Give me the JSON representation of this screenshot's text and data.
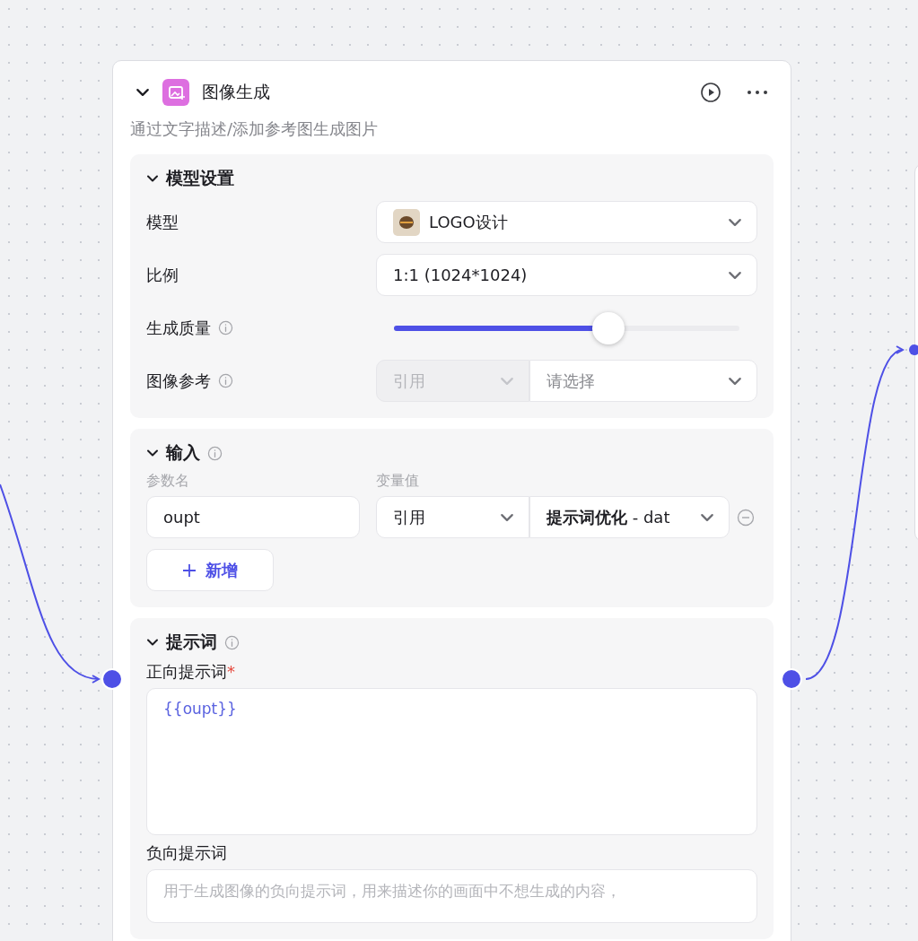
{
  "node": {
    "title": "图像生成",
    "description": "通过文字描述/添加参考图生成图片",
    "expanded": true
  },
  "sections": [
    {
      "kind": "settings",
      "title": "模型设置",
      "info": false,
      "expanded": true,
      "rows": [
        {
          "kind": "select",
          "label": "模型",
          "value": "LOGO设计",
          "thumbnail": true,
          "info": false
        },
        {
          "kind": "select",
          "label": "比例",
          "value": "1:1 (1024*1024)",
          "thumbnail": false,
          "info": false
        },
        {
          "kind": "slider",
          "label": "生成质量",
          "info": true,
          "level": 0.62
        },
        {
          "kind": "ref",
          "label": "图像参考",
          "info": true,
          "source": "引用",
          "source_disabled": true,
          "placeholder": "请选择"
        }
      ]
    },
    {
      "kind": "inputs",
      "title": "输入",
      "info": true,
      "expanded": true,
      "headers": [
        "参数名",
        "变量值"
      ],
      "params": [
        {
          "name": "oupt",
          "source": "引用",
          "source_disabled": false,
          "value": "**提示词优化** - dat"
        }
      ],
      "add_label": "新增"
    },
    {
      "kind": "prompts",
      "title": "提示词",
      "info": true,
      "expanded": true,
      "fields": [
        {
          "label": "正向提示词",
          "required": true,
          "required_mark": "*",
          "value": "{{oupt}}"
        },
        {
          "label": "负向提示词",
          "required": false,
          "placeholder": "用于生成图像的负向提示词，用来描述你的画面中不想生成的内容，"
        }
      ]
    }
  ]
}
